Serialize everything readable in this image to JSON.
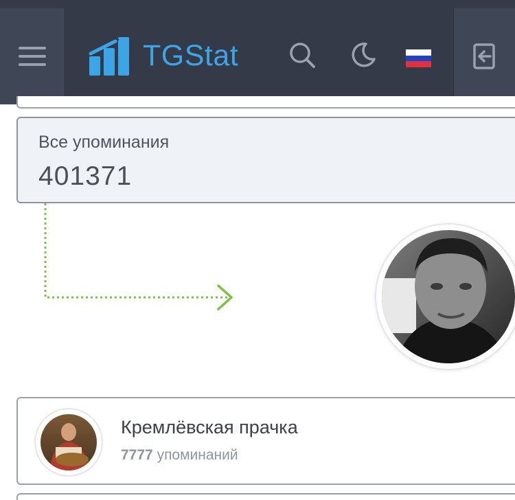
{
  "header": {
    "brand": "TGStat",
    "flag_colors": [
      "#ffffff",
      "#1f45c6",
      "#e5303d"
    ]
  },
  "stats": {
    "label": "Все упоминания",
    "value": "401371"
  },
  "channel": {
    "name": "Кремлёвская прачка",
    "mentions_count": "7777",
    "mentions_suffix": "упоминаний"
  },
  "colors": {
    "header_bg": "#343a48",
    "brand_blue": "#3aa6e8",
    "connector_green": "#7cc142"
  }
}
